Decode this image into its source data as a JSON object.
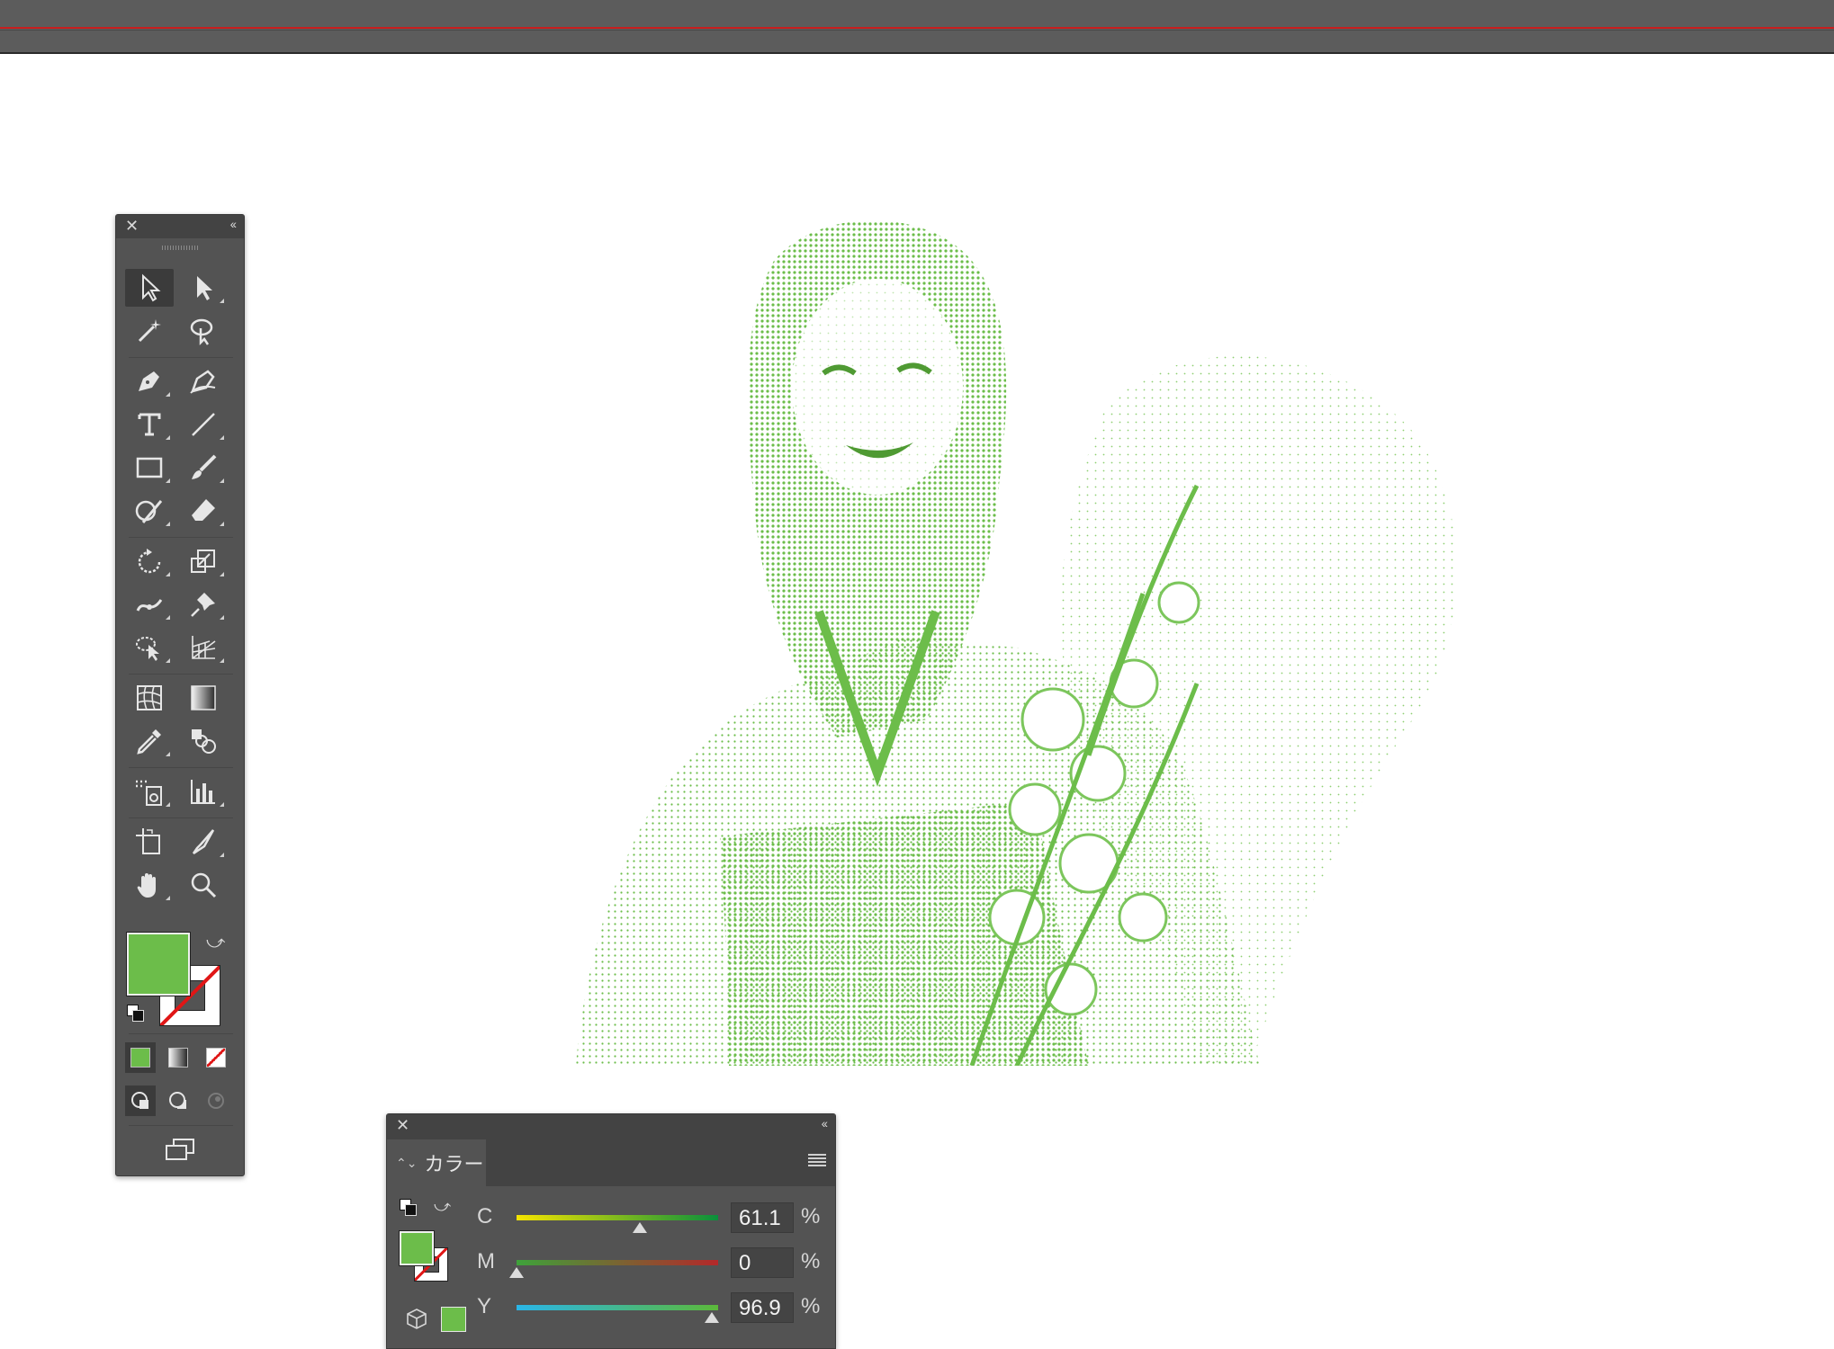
{
  "window": {
    "topbar": ""
  },
  "tools_panel": {
    "close_glyph": "✕",
    "collapse_glyph": "‹‹",
    "tools": [
      {
        "name": "selection-tool",
        "selected": true
      },
      {
        "name": "direct-selection-tool"
      },
      {
        "name": "magic-wand-tool"
      },
      {
        "name": "lasso-tool"
      },
      {
        "name": "pen-tool"
      },
      {
        "name": "curvature-tool"
      },
      {
        "name": "type-tool"
      },
      {
        "name": "line-segment-tool"
      },
      {
        "name": "rectangle-tool"
      },
      {
        "name": "paintbrush-tool"
      },
      {
        "name": "shaper-tool"
      },
      {
        "name": "eraser-tool"
      },
      {
        "name": "rotate-tool"
      },
      {
        "name": "scale-tool"
      },
      {
        "name": "width-tool"
      },
      {
        "name": "puppet-warp-tool"
      },
      {
        "name": "shape-builder-tool"
      },
      {
        "name": "perspective-grid-tool"
      },
      {
        "name": "mesh-tool"
      },
      {
        "name": "gradient-tool"
      },
      {
        "name": "eyedropper-tool"
      },
      {
        "name": "blend-tool"
      },
      {
        "name": "symbol-sprayer-tool"
      },
      {
        "name": "column-graph-tool"
      },
      {
        "name": "artboard-tool"
      },
      {
        "name": "slice-tool"
      },
      {
        "name": "hand-tool"
      },
      {
        "name": "zoom-tool"
      }
    ],
    "fill_color": "#6cbd4a",
    "stroke_color": "none"
  },
  "color_panel": {
    "close_glyph": "✕",
    "collapse_glyph": "‹‹",
    "tab_label": "カラー",
    "tab_arrows": "⌃⌄",
    "fill_color": "#6cbd4a",
    "sliders": [
      {
        "label": "C",
        "value": "61.1",
        "level": 0.611,
        "unit": "%",
        "gradient": [
          "#f5e400",
          "#0a8f3c"
        ]
      },
      {
        "label": "M",
        "value": "0",
        "level": 0.0,
        "unit": "%",
        "gradient": [
          "#3ea23a",
          "#b4282a"
        ]
      },
      {
        "label": "Y",
        "value": "96.9",
        "level": 0.969,
        "unit": "%",
        "gradient": [
          "#2ab6e8",
          "#5cb83a"
        ]
      }
    ]
  },
  "artwork": {
    "tint": "#6cbd4a"
  }
}
